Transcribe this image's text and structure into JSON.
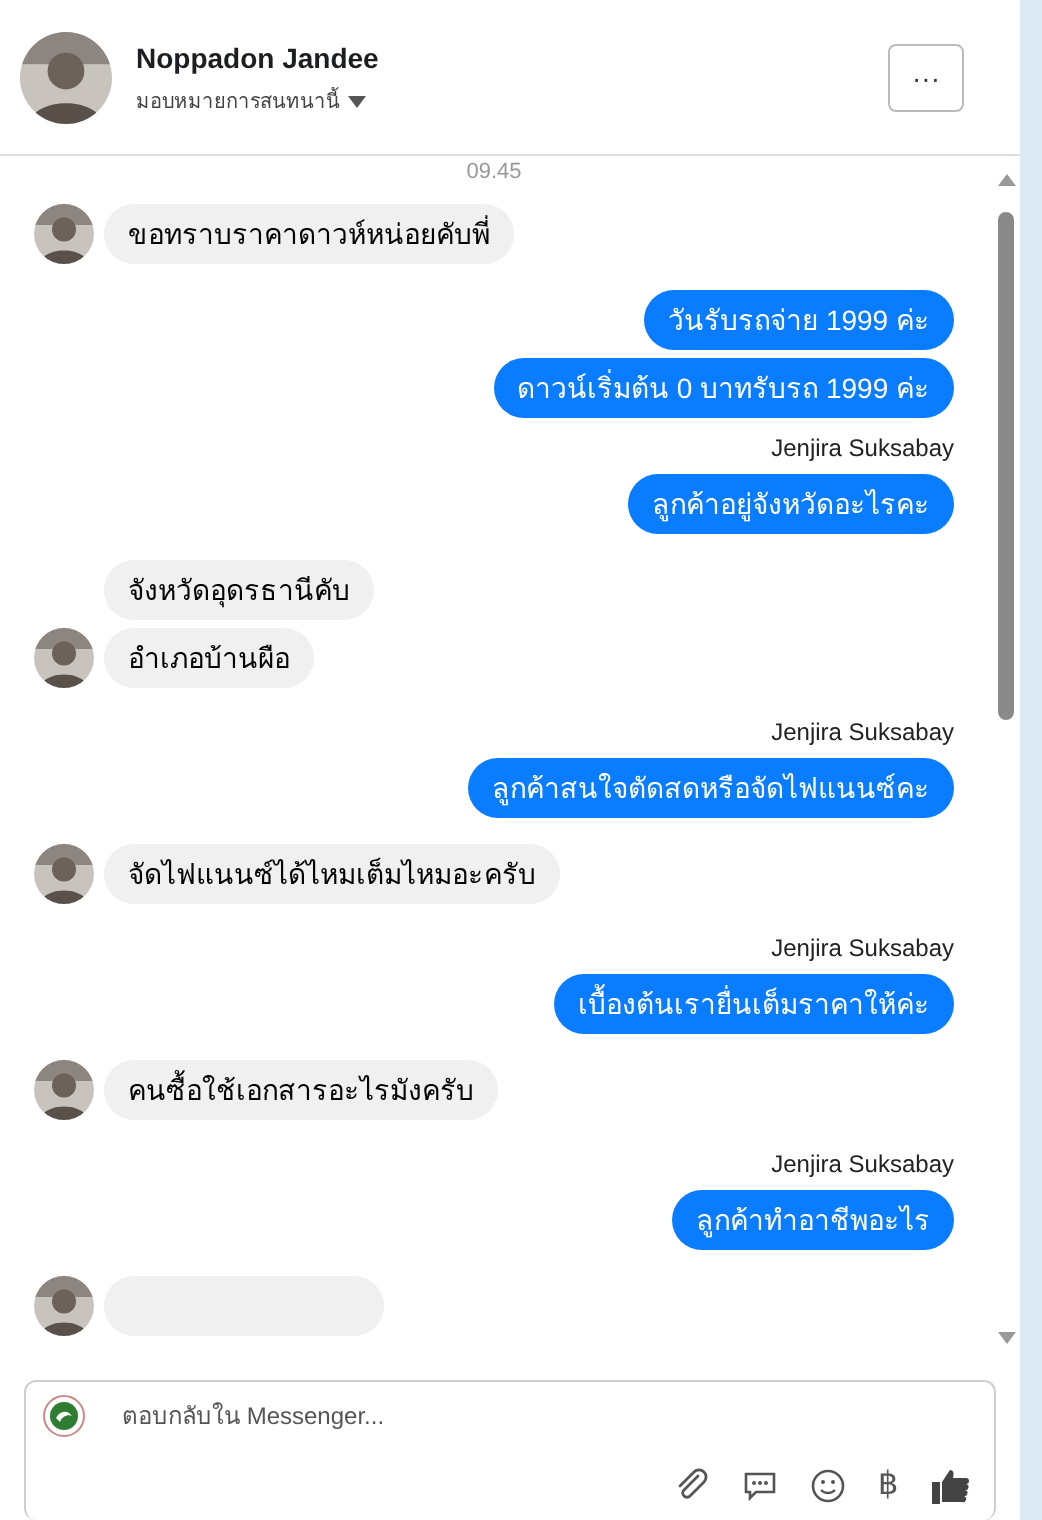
{
  "header": {
    "name": "Noppadon Jandee",
    "subtitle": "มอบหมายการสนทนานี้",
    "more_label": "···"
  },
  "thread": [
    {
      "kind": "time",
      "text": "09.45"
    },
    {
      "kind": "incoming",
      "text": "ขอทราบราคาดาวห์หน่อยคับพี่",
      "avatar": true
    },
    {
      "kind": "outgoing",
      "text": "วันรับรถจ่าย 1999 ค่ะ"
    },
    {
      "kind": "outgoing",
      "text": "ดาวน์เริ่มต้น 0 บาทรับรถ 1999 ค่ะ"
    },
    {
      "kind": "sender",
      "text": "Jenjira Suksabay"
    },
    {
      "kind": "outgoing",
      "text": "ลูกค้าอยู่จังหวัดอะไรคะ"
    },
    {
      "kind": "incoming",
      "text": "จังหวัดอุดรธานีคับ",
      "avatar": false
    },
    {
      "kind": "incoming",
      "text": "อำเภอบ้านผือ",
      "avatar": true
    },
    {
      "kind": "sender",
      "text": "Jenjira Suksabay"
    },
    {
      "kind": "outgoing",
      "text": "ลูกค้าสนใจตัดสดหรือจัดไฟแนนซ์คะ"
    },
    {
      "kind": "incoming",
      "text": "จัดไฟแนนซ์ได้ไหมเต็มไหมอะครับ",
      "avatar": true
    },
    {
      "kind": "sender",
      "text": "Jenjira Suksabay"
    },
    {
      "kind": "outgoing",
      "text": "เบื้องต้นเรายื่นเต็มราคาให้ค่ะ"
    },
    {
      "kind": "incoming",
      "text": "คนซื้อใช้เอกสารอะไรมังครับ",
      "avatar": true
    },
    {
      "kind": "sender",
      "text": "Jenjira Suksabay"
    },
    {
      "kind": "outgoing",
      "text": "ลูกค้าทำอาชีพอะไร"
    },
    {
      "kind": "incoming_cut",
      "avatar": true
    }
  ],
  "composer": {
    "placeholder": "ตอบกลับใน Messenger...",
    "currency_symbol": "฿"
  }
}
